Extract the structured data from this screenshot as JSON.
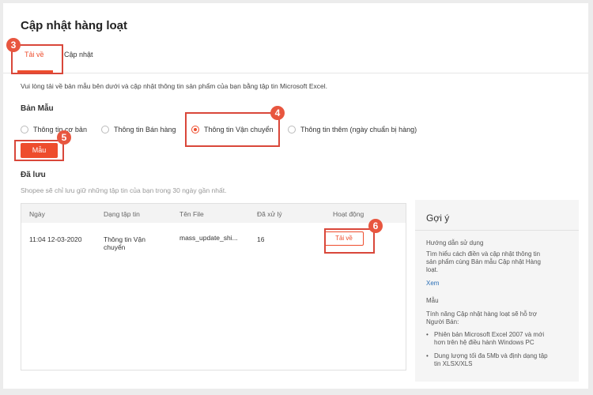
{
  "page": {
    "title": "Cập nhật hàng loạt"
  },
  "tabs": [
    {
      "label": "Tải về"
    },
    {
      "label": "Cập nhật"
    }
  ],
  "intro_text": "Vui lòng tải về bản mẫu bên dưới và cập nhật thông tin sản phẩm của bạn bằng tập tin Microsoft Excel.",
  "template": {
    "title": "Bản Mẫu",
    "options": [
      {
        "label": "Thông tin cơ bản"
      },
      {
        "label": "Thông tin Bán hàng"
      },
      {
        "label": "Thông tin Vận chuyển"
      },
      {
        "label": "Thông tin thêm (ngày chuẩn bị hàng)"
      }
    ],
    "selected_option": "Thông tin Vận chuyển",
    "button_label": "Mẫu"
  },
  "saved": {
    "title": "Đã lưu",
    "note": "Shopee sẽ chỉ lưu giữ những tập tin của bạn trong 30 ngày gần nhất.",
    "columns": [
      "Ngày",
      "Dạng tập tin",
      "Tên File",
      "Đã xử lý",
      "Hoạt động"
    ],
    "rows": [
      {
        "date": "11:04 12-03-2020",
        "type_line1": "Thông tin Vận",
        "type_line2": "chuyển",
        "file_name": "mass_update_shi...",
        "processed": "16",
        "action": "Tải về"
      }
    ]
  },
  "sidebar": {
    "title": "Gợi ý",
    "guide_heading": "Hướng dẫn sử dụng",
    "guide_line1": "Tìm hiểu cách điền và cập nhật thông tin",
    "guide_line2": "sản phẩm cùng Bản mẫu Cập nhật Hàng",
    "guide_line3": "loạt.",
    "guide_link": "Xem",
    "template_heading": "Mẫu",
    "template_line1": "Tính năng Cập nhật hàng loạt sẽ hỗ trợ",
    "template_line2": "Người Bán:",
    "bullets": [
      {
        "line1": "Phiên bản Microsoft Excel 2007 và mới",
        "line2": "hơn trên hệ điều hành Windows PC"
      },
      {
        "line1": "Dung lượng tối đa 5Mb và định dạng tập",
        "line2": "tin XLSX/XLS"
      }
    ]
  },
  "annotations": [
    "3",
    "4",
    "5",
    "6"
  ],
  "colors": {
    "accent": "#ee4d2d",
    "annotation": "#e8563f"
  }
}
